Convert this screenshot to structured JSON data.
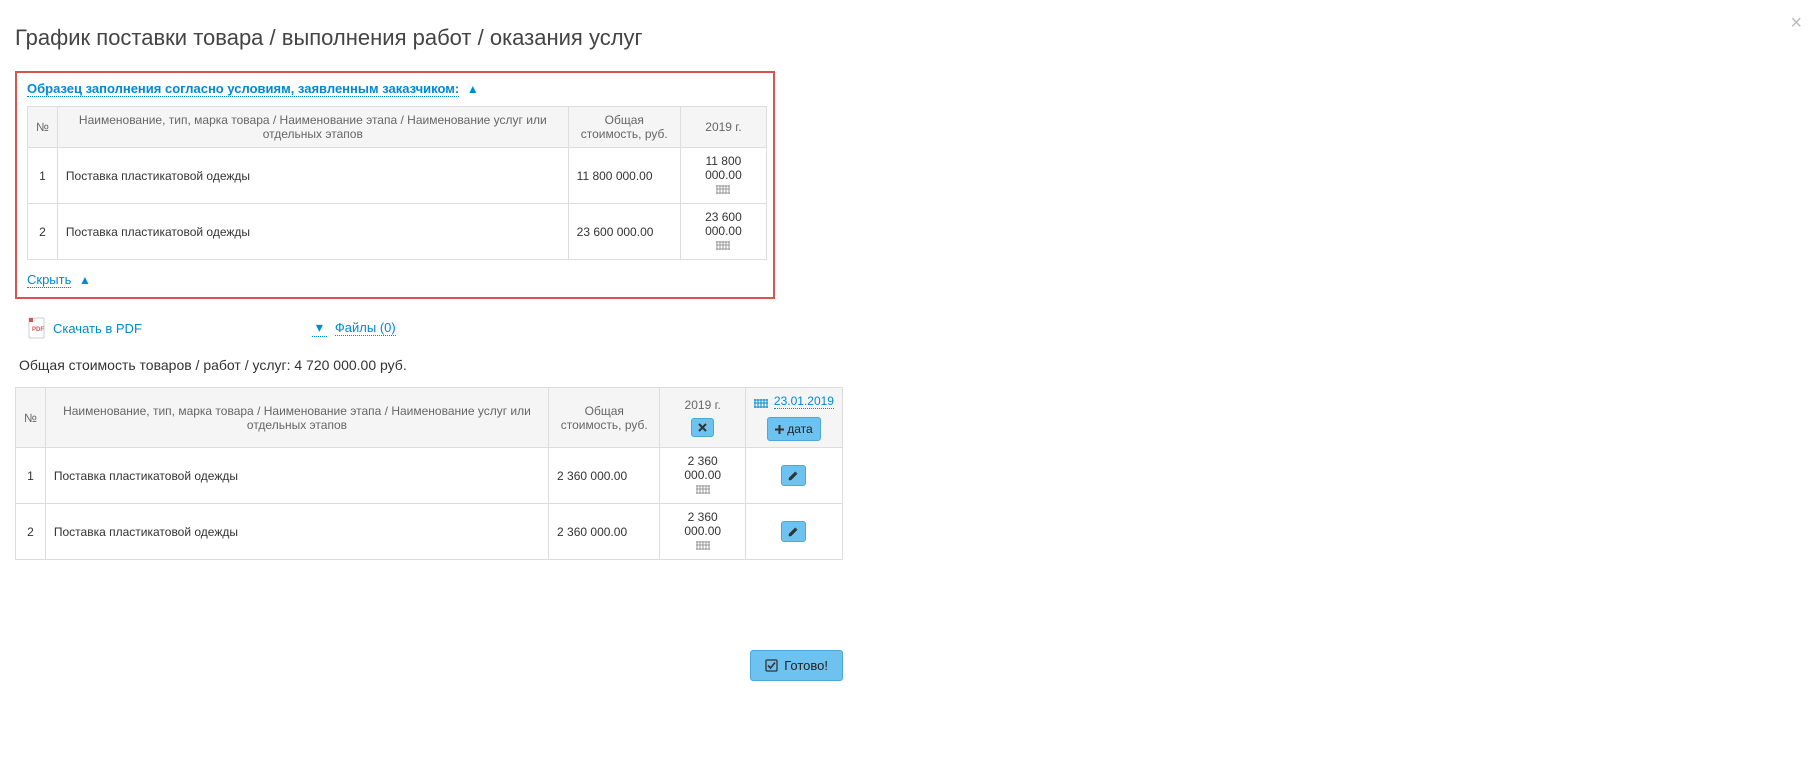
{
  "title": "График поставки товара / выполнения работ / оказания услуг",
  "sample": {
    "heading": "Образец заполнения согласно условиям, заявленным заказчиком:",
    "columns": {
      "num": "№",
      "name": "Наименование, тип, марка товара / Наименование этапа / Наименование услуг или отдельных этапов",
      "cost": "Общая стоимость, руб.",
      "year": "2019 г."
    },
    "rows": [
      {
        "num": "1",
        "name": "Поставка пластикатовой одежды",
        "cost": "11 800 000.00",
        "year_val": "11 800 000.00"
      },
      {
        "num": "2",
        "name": "Поставка пластикатовой одежды",
        "cost": "23 600 000.00",
        "year_val": "23 600 000.00"
      }
    ],
    "hide": "Скрыть"
  },
  "actions": {
    "pdf": "Скачать в PDF",
    "files": "Файлы (0)"
  },
  "total_line": "Общая стоимость товаров / работ / услуг: 4 720 000.00 руб.",
  "main": {
    "columns": {
      "num": "№",
      "name": "Наименование, тип, марка товара / Наименование этапа / Наименование услуг или отдельных этапов",
      "cost": "Общая стоимость, руб.",
      "year": "2019 г.",
      "date": "23.01.2019",
      "add_date_label": "дата"
    },
    "rows": [
      {
        "num": "1",
        "name": "Поставка пластикатовой одежды",
        "cost": "2 360 000.00",
        "year_val": "2 360 000.00"
      },
      {
        "num": "2",
        "name": "Поставка пластикатовой одежды",
        "cost": "2 360 000.00",
        "year_val": "2 360 000.00"
      }
    ]
  },
  "ready": "Готово!"
}
